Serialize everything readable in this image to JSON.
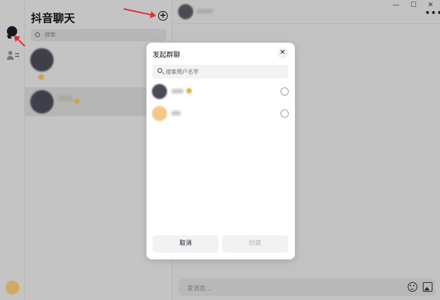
{
  "app": {
    "title": "抖音聊天"
  },
  "list": {
    "search_placeholder": "搜索"
  },
  "chat": {
    "composer_placeholder": "发消息..."
  },
  "modal": {
    "title": "发起群聊",
    "close_glyph": "✕",
    "search_placeholder": "搜索用户名字",
    "cancel_label": "取消",
    "create_label": "创建"
  },
  "window_controls": {
    "minimize": "—",
    "maximize": "☐",
    "close": "✕"
  },
  "colors": {
    "annotation_arrow": "#e8262e",
    "overlay": "#bfbfbf",
    "modal_bg": "#ffffff"
  }
}
